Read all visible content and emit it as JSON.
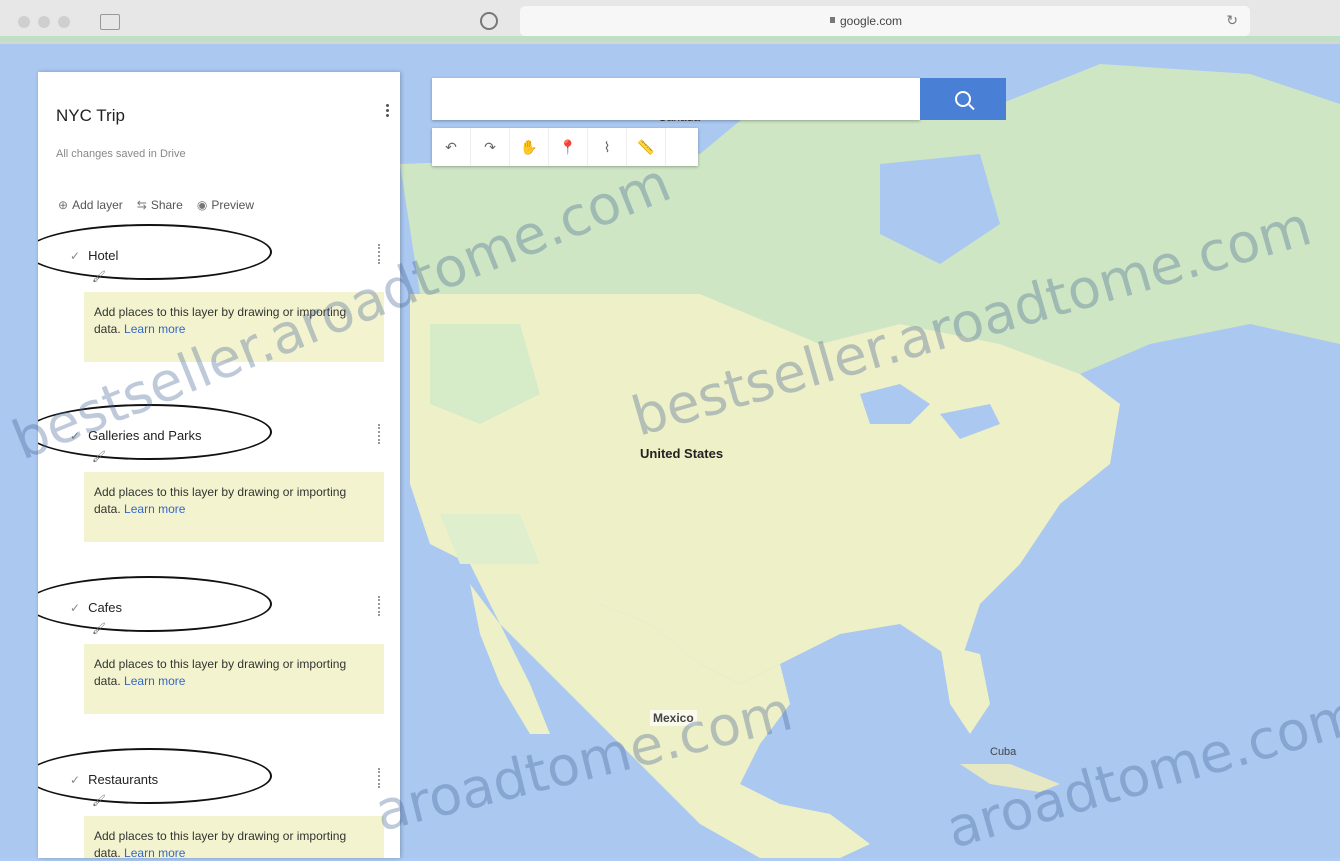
{
  "browser": {
    "url": "google.com",
    "tab_caption": "Canada"
  },
  "search": {
    "placeholder": ""
  },
  "map_tools": [
    "↶",
    "↷",
    "✋",
    "📍",
    "⌇",
    "📏"
  ],
  "panel": {
    "title": "NYC Trip",
    "subtitle": "All changes saved in Drive",
    "actions": [
      {
        "icon": "add-layer-icon",
        "label": "Add layer"
      },
      {
        "icon": "share-icon",
        "label": "Share"
      },
      {
        "icon": "preview-icon",
        "label": "Preview"
      }
    ],
    "layers": [
      {
        "name": "Hotel",
        "hint": "Add places to this layer by drawing or importing data.",
        "link": "Learn more"
      },
      {
        "name": "Galleries and Parks",
        "hint": "Add places to this layer by drawing or importing data.",
        "link": "Learn more"
      },
      {
        "name": "Cafes",
        "hint": "Add places to this layer by drawing or importing data.",
        "link": "Learn more"
      },
      {
        "name": "Restaurants",
        "hint": "Add places to this layer by drawing or importing data.",
        "link": "Learn more"
      }
    ]
  },
  "map": {
    "labels": {
      "united_states": "United States",
      "mexico": "Mexico",
      "cuba": "Cuba"
    }
  },
  "watermark": {
    "text_1": "bestseller.aroadtome.com",
    "text_2": "bestseller.aroadtome.com",
    "text_3": "aroadtome.com",
    "text_4": "aroadtome.com"
  }
}
